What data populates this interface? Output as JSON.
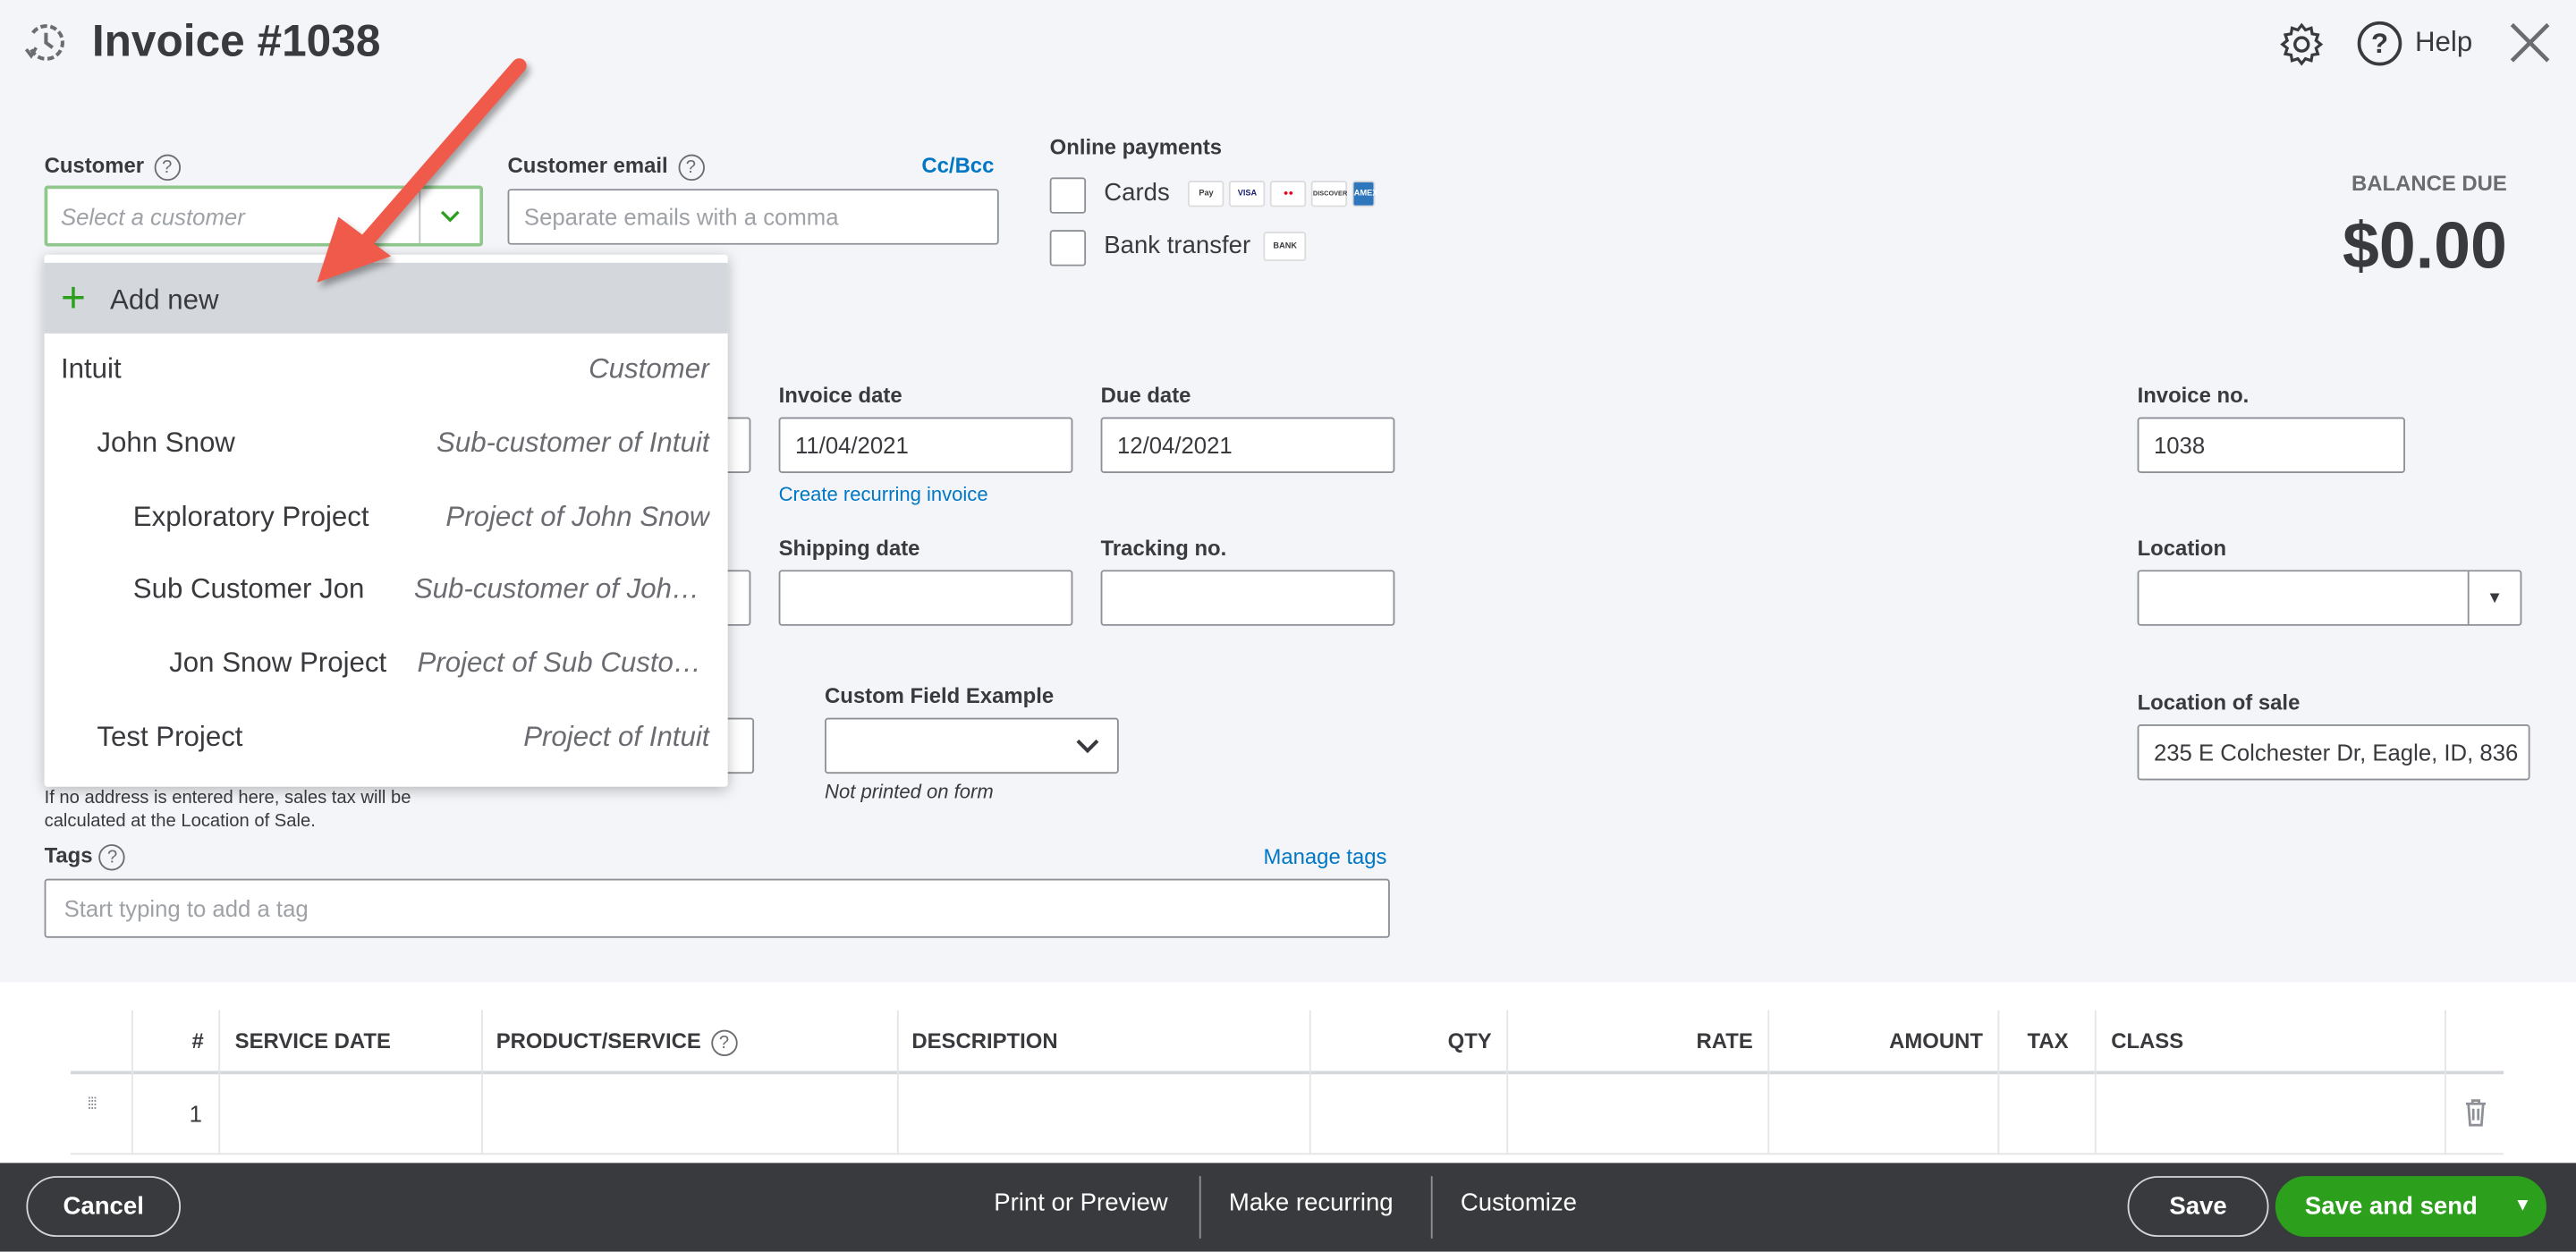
{
  "header": {
    "title": "Invoice #1038",
    "help_label": "Help"
  },
  "customer": {
    "label": "Customer",
    "placeholder": "Select a customer"
  },
  "customer_email": {
    "label": "Customer email",
    "placeholder": "Separate emails with a comma",
    "cc_bcc": "Cc/Bcc"
  },
  "online_payments": {
    "label": "Online payments",
    "cards_label": "Cards",
    "card_logos": [
      "Pay",
      "VISA",
      "MC",
      "DISCOVER",
      "AMEX"
    ],
    "bank_label": "Bank transfer",
    "bank_logo": "BANK",
    "cards_checked": false,
    "bank_checked": false
  },
  "balance": {
    "label": "BALANCE DUE",
    "amount": "$0.00"
  },
  "dropdown": {
    "add_new": "Add new",
    "items": [
      {
        "name": "Intuit",
        "type": "Customer"
      },
      {
        "name": "John Snow",
        "type": "Sub-customer of Intuit"
      },
      {
        "name": "Exploratory Project",
        "type": "Project of John Snow"
      },
      {
        "name": "Sub Customer Jon",
        "type": "Sub-customer of John Snow"
      },
      {
        "name": "Jon Snow Project",
        "type": "Project of Sub Customer Jon"
      },
      {
        "name": "Test Project",
        "type": "Project of Intuit"
      }
    ]
  },
  "invoice_date": {
    "label": "Invoice date",
    "value": "11/04/2021"
  },
  "due_date": {
    "label": "Due date",
    "value": "12/04/2021"
  },
  "create_recurring": "Create recurring invoice",
  "shipping_date": {
    "label": "Shipping date",
    "value": ""
  },
  "tracking_no": {
    "label": "Tracking no.",
    "value": ""
  },
  "invoice_no": {
    "label": "Invoice no.",
    "value": "1038"
  },
  "location": {
    "label": "Location",
    "value": ""
  },
  "custom_field": {
    "label": "Custom Field Example",
    "value": "",
    "note": "Not printed on form"
  },
  "location_of_sale": {
    "label": "Location of sale",
    "value": "235 E Colchester Dr, Eagle, ID, 836"
  },
  "address_note": "If no address is entered here, sales tax will be calculated at the Location of Sale.",
  "tags": {
    "label": "Tags",
    "manage": "Manage tags",
    "placeholder": "Start typing to add a tag"
  },
  "table": {
    "headers": [
      "#",
      "SERVICE DATE",
      "PRODUCT/SERVICE",
      "DESCRIPTION",
      "QTY",
      "RATE",
      "AMOUNT",
      "TAX",
      "CLASS"
    ],
    "rows": [
      {
        "num": "1"
      }
    ]
  },
  "footer": {
    "cancel": "Cancel",
    "print": "Print or Preview",
    "recurring": "Make recurring",
    "customize": "Customize",
    "save": "Save",
    "save_send": "Save and send"
  },
  "colors": {
    "accent_green": "#2ca01c",
    "link_blue": "#0077c5",
    "footer_bg": "#393a3d",
    "annotation_arrow": "#f05a4a"
  }
}
